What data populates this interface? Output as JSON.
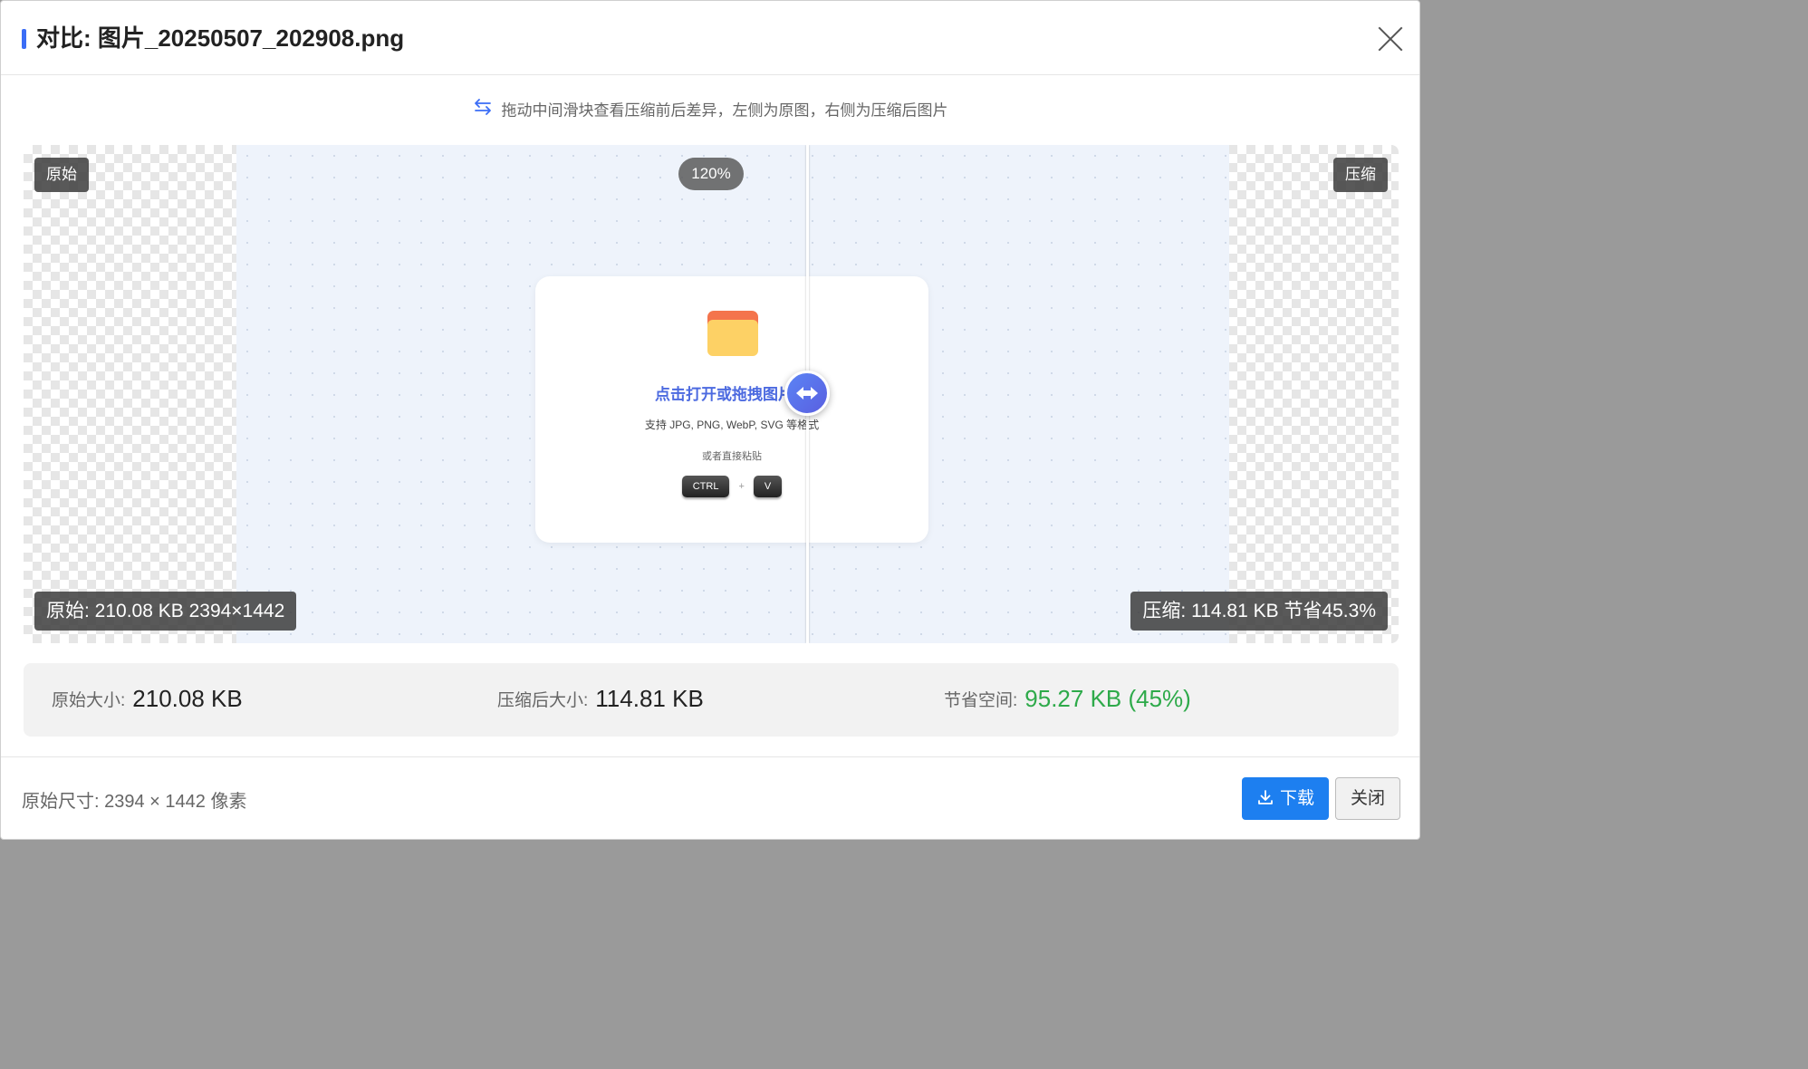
{
  "dialog": {
    "title": "对比: 图片_20250507_202908.png",
    "close_icon": "close-icon"
  },
  "hint": {
    "icon": "swap-arrows-icon",
    "text": "拖动中间滑块查看压缩前后差异，左侧为原图，右侧为压缩后图片"
  },
  "compare": {
    "zoom": "120%",
    "left_tag": "原始",
    "right_tag": "压缩",
    "left_info": "原始: 210.08 KB 2394×1442",
    "right_info": "压缩: 114.81 KB 节省45.3%",
    "slider_position": 0.57,
    "preview": {
      "title": "点击打开或拖拽图片到",
      "subtitle": "支持 JPG, PNG, WebP, SVG 等格式",
      "or_text": "或者直接粘贴",
      "key1": "CTRL",
      "plus": "+",
      "key2": "V"
    }
  },
  "stats": {
    "original_label": "原始大小:",
    "original_value": "210.08 KB",
    "compressed_label": "压缩后大小:",
    "compressed_value": "114.81 KB",
    "saved_label": "节省空间:",
    "saved_value": "95.27 KB (45%)",
    "saved_color": "#2eaa4a"
  },
  "footer": {
    "dimensions": "原始尺寸: 2394 × 1442 像素",
    "download_label": "下载",
    "close_label": "关闭",
    "accent": "#1d7ff0"
  }
}
